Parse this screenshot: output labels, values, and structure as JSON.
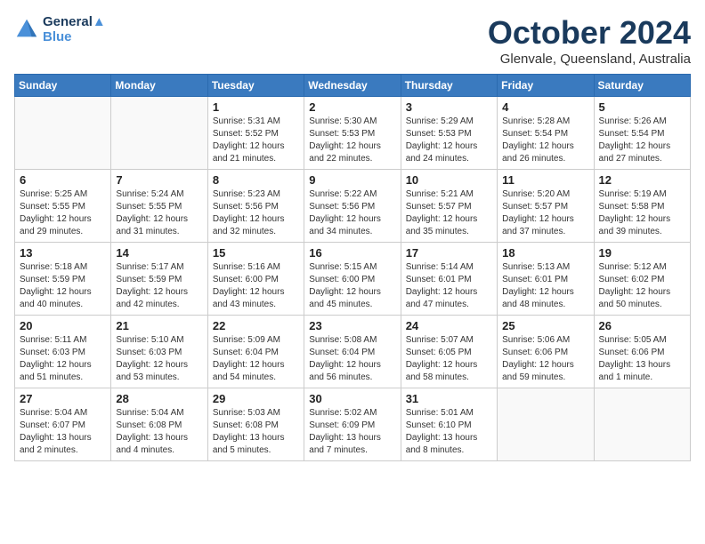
{
  "header": {
    "logo_line1": "General",
    "logo_line2": "Blue",
    "month": "October 2024",
    "location": "Glenvale, Queensland, Australia"
  },
  "weekdays": [
    "Sunday",
    "Monday",
    "Tuesday",
    "Wednesday",
    "Thursday",
    "Friday",
    "Saturday"
  ],
  "weeks": [
    [
      {
        "day": "",
        "info": ""
      },
      {
        "day": "",
        "info": ""
      },
      {
        "day": "1",
        "info": "Sunrise: 5:31 AM\nSunset: 5:52 PM\nDaylight: 12 hours and 21 minutes."
      },
      {
        "day": "2",
        "info": "Sunrise: 5:30 AM\nSunset: 5:53 PM\nDaylight: 12 hours and 22 minutes."
      },
      {
        "day": "3",
        "info": "Sunrise: 5:29 AM\nSunset: 5:53 PM\nDaylight: 12 hours and 24 minutes."
      },
      {
        "day": "4",
        "info": "Sunrise: 5:28 AM\nSunset: 5:54 PM\nDaylight: 12 hours and 26 minutes."
      },
      {
        "day": "5",
        "info": "Sunrise: 5:26 AM\nSunset: 5:54 PM\nDaylight: 12 hours and 27 minutes."
      }
    ],
    [
      {
        "day": "6",
        "info": "Sunrise: 5:25 AM\nSunset: 5:55 PM\nDaylight: 12 hours and 29 minutes."
      },
      {
        "day": "7",
        "info": "Sunrise: 5:24 AM\nSunset: 5:55 PM\nDaylight: 12 hours and 31 minutes."
      },
      {
        "day": "8",
        "info": "Sunrise: 5:23 AM\nSunset: 5:56 PM\nDaylight: 12 hours and 32 minutes."
      },
      {
        "day": "9",
        "info": "Sunrise: 5:22 AM\nSunset: 5:56 PM\nDaylight: 12 hours and 34 minutes."
      },
      {
        "day": "10",
        "info": "Sunrise: 5:21 AM\nSunset: 5:57 PM\nDaylight: 12 hours and 35 minutes."
      },
      {
        "day": "11",
        "info": "Sunrise: 5:20 AM\nSunset: 5:57 PM\nDaylight: 12 hours and 37 minutes."
      },
      {
        "day": "12",
        "info": "Sunrise: 5:19 AM\nSunset: 5:58 PM\nDaylight: 12 hours and 39 minutes."
      }
    ],
    [
      {
        "day": "13",
        "info": "Sunrise: 5:18 AM\nSunset: 5:59 PM\nDaylight: 12 hours and 40 minutes."
      },
      {
        "day": "14",
        "info": "Sunrise: 5:17 AM\nSunset: 5:59 PM\nDaylight: 12 hours and 42 minutes."
      },
      {
        "day": "15",
        "info": "Sunrise: 5:16 AM\nSunset: 6:00 PM\nDaylight: 12 hours and 43 minutes."
      },
      {
        "day": "16",
        "info": "Sunrise: 5:15 AM\nSunset: 6:00 PM\nDaylight: 12 hours and 45 minutes."
      },
      {
        "day": "17",
        "info": "Sunrise: 5:14 AM\nSunset: 6:01 PM\nDaylight: 12 hours and 47 minutes."
      },
      {
        "day": "18",
        "info": "Sunrise: 5:13 AM\nSunset: 6:01 PM\nDaylight: 12 hours and 48 minutes."
      },
      {
        "day": "19",
        "info": "Sunrise: 5:12 AM\nSunset: 6:02 PM\nDaylight: 12 hours and 50 minutes."
      }
    ],
    [
      {
        "day": "20",
        "info": "Sunrise: 5:11 AM\nSunset: 6:03 PM\nDaylight: 12 hours and 51 minutes."
      },
      {
        "day": "21",
        "info": "Sunrise: 5:10 AM\nSunset: 6:03 PM\nDaylight: 12 hours and 53 minutes."
      },
      {
        "day": "22",
        "info": "Sunrise: 5:09 AM\nSunset: 6:04 PM\nDaylight: 12 hours and 54 minutes."
      },
      {
        "day": "23",
        "info": "Sunrise: 5:08 AM\nSunset: 6:04 PM\nDaylight: 12 hours and 56 minutes."
      },
      {
        "day": "24",
        "info": "Sunrise: 5:07 AM\nSunset: 6:05 PM\nDaylight: 12 hours and 58 minutes."
      },
      {
        "day": "25",
        "info": "Sunrise: 5:06 AM\nSunset: 6:06 PM\nDaylight: 12 hours and 59 minutes."
      },
      {
        "day": "26",
        "info": "Sunrise: 5:05 AM\nSunset: 6:06 PM\nDaylight: 13 hours and 1 minute."
      }
    ],
    [
      {
        "day": "27",
        "info": "Sunrise: 5:04 AM\nSunset: 6:07 PM\nDaylight: 13 hours and 2 minutes."
      },
      {
        "day": "28",
        "info": "Sunrise: 5:04 AM\nSunset: 6:08 PM\nDaylight: 13 hours and 4 minutes."
      },
      {
        "day": "29",
        "info": "Sunrise: 5:03 AM\nSunset: 6:08 PM\nDaylight: 13 hours and 5 minutes."
      },
      {
        "day": "30",
        "info": "Sunrise: 5:02 AM\nSunset: 6:09 PM\nDaylight: 13 hours and 7 minutes."
      },
      {
        "day": "31",
        "info": "Sunrise: 5:01 AM\nSunset: 6:10 PM\nDaylight: 13 hours and 8 minutes."
      },
      {
        "day": "",
        "info": ""
      },
      {
        "day": "",
        "info": ""
      }
    ]
  ]
}
